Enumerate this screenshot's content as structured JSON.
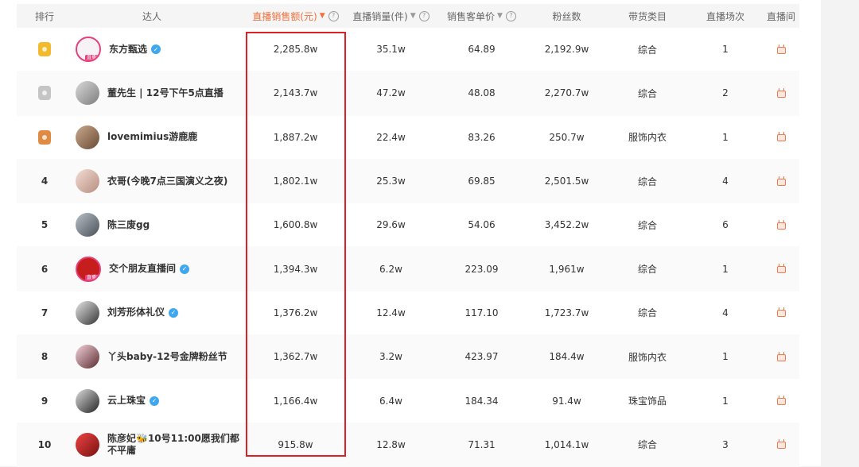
{
  "columns": {
    "rank": "排行",
    "name": "达人",
    "sales": "直播销售额(元)",
    "volume": "直播销量(件)",
    "price": "销售客单价",
    "fans": "粉丝数",
    "category": "带货类目",
    "sessions": "直播场次",
    "room": "直播间"
  },
  "colors": {
    "accent": "#f0713e",
    "highlight": "#e02020",
    "verified": "#3ea7f0"
  },
  "rows": [
    {
      "rank": "",
      "medal": "gold",
      "name": "东方甄选",
      "verified": true,
      "live_tag": "直播中",
      "sales": "2,285.8w",
      "volume": "35.1w",
      "price": "64.89",
      "fans": "2,192.9w",
      "category": "综合",
      "sessions": "1"
    },
    {
      "rank": "",
      "medal": "silver",
      "name": "董先生 | 12号下午5点直播",
      "verified": false,
      "sales": "2,143.7w",
      "volume": "47.2w",
      "price": "48.08",
      "fans": "2,270.7w",
      "category": "综合",
      "sessions": "2"
    },
    {
      "rank": "",
      "medal": "bronze",
      "name": "lovemimius游鹿鹿",
      "verified": false,
      "sales": "1,887.2w",
      "volume": "22.4w",
      "price": "83.26",
      "fans": "250.7w",
      "category": "服饰内衣",
      "sessions": "1"
    },
    {
      "rank": "4",
      "name": "衣哥(今晚7点三国演义之夜)",
      "verified": false,
      "sales": "1,802.1w",
      "volume": "25.3w",
      "price": "69.85",
      "fans": "2,501.5w",
      "category": "综合",
      "sessions": "4"
    },
    {
      "rank": "5",
      "name": "陈三废gg",
      "verified": false,
      "sales": "1,600.8w",
      "volume": "29.6w",
      "price": "54.06",
      "fans": "3,452.2w",
      "category": "综合",
      "sessions": "6"
    },
    {
      "rank": "6",
      "name": "交个朋友直播间",
      "verified": true,
      "live_tag": "直播中",
      "sales": "1,394.3w",
      "volume": "6.2w",
      "price": "223.09",
      "fans": "1,961w",
      "category": "综合",
      "sessions": "1"
    },
    {
      "rank": "7",
      "name": "刘芳形体礼仪",
      "verified": true,
      "sales": "1,376.2w",
      "volume": "12.4w",
      "price": "117.10",
      "fans": "1,723.7w",
      "category": "综合",
      "sessions": "4"
    },
    {
      "rank": "8",
      "name": "丫头baby-12号金牌粉丝节",
      "verified": false,
      "sales": "1,362.7w",
      "volume": "3.2w",
      "price": "423.97",
      "fans": "184.4w",
      "category": "服饰内衣",
      "sessions": "1"
    },
    {
      "rank": "9",
      "name": "云上珠宝",
      "verified": true,
      "sales": "1,166.4w",
      "volume": "6.4w",
      "price": "184.34",
      "fans": "91.4w",
      "category": "珠宝饰品",
      "sessions": "1"
    },
    {
      "rank": "10",
      "name": "陈彦妃🐝10号11:00愿我们都不平庸",
      "verified": false,
      "sales": "915.8w",
      "volume": "12.8w",
      "price": "71.31",
      "fans": "1,014.1w",
      "category": "综合",
      "sessions": "3"
    }
  ]
}
